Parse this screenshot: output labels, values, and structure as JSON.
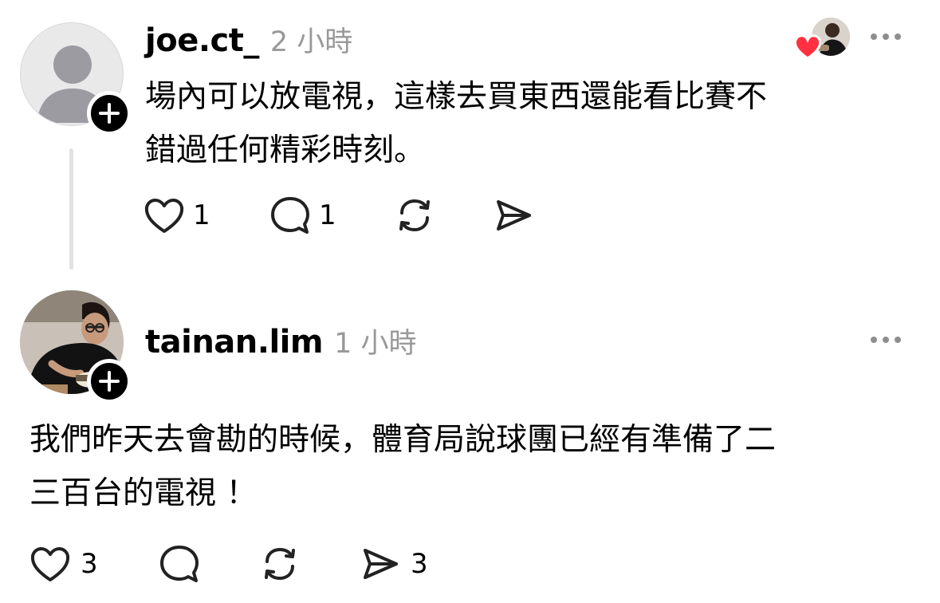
{
  "post1": {
    "username": "joe.ct_",
    "time": "2 小時",
    "text_line1": "場內可以放電視，這樣去買東西還能看比賽不",
    "text_line2": "錯過任何精彩時刻。",
    "like_count": "1",
    "reply_count": "1"
  },
  "post2": {
    "username": "tainan.lim",
    "time": "1 小時",
    "text_line1": "我們昨天去會勘的時候，體育局說球團已經有準備了二",
    "text_line2": "三百台的電視 ！",
    "like_count": "3",
    "share_count": "3"
  },
  "colors": {
    "heart_red": "#ff3040",
    "muted_gray": "#999999",
    "thread_line": "#e2e2e2"
  },
  "icons": [
    "heart-icon",
    "comment-icon",
    "repost-icon",
    "share-icon",
    "more-icon",
    "plus-icon"
  ]
}
